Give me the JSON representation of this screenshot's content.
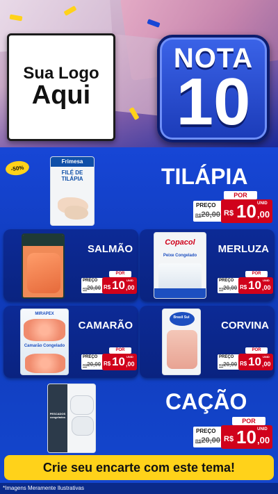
{
  "header": {
    "logo_line1": "Sua Logo",
    "logo_line2": "Aqui",
    "nota_word": "NOTA",
    "nota_number": "10"
  },
  "discount_badge": "-50%",
  "products": [
    {
      "name": "TILÁPIA",
      "brand": "Frimesa",
      "pkg_text": "FILÉ DE TILÁPIA",
      "por": "POR",
      "preco": "PREÇO",
      "old_prefix": "R$",
      "old": "20,00",
      "rs": "R$",
      "new_int": "10",
      "new_dec": ",00",
      "unid": "UNID"
    },
    {
      "name": "SALMÃO",
      "por": "POR",
      "preco": "PREÇO",
      "old_prefix": "R$",
      "old": "20,00",
      "rs": "R$",
      "new_int": "10",
      "new_dec": ",00",
      "unid": "UNID"
    },
    {
      "name": "MERLUZA",
      "brand": "Copacol",
      "pkg_text": "Peixe Congelado",
      "por": "POR",
      "preco": "PREÇO",
      "old_prefix": "R$",
      "old": "20,00",
      "rs": "R$",
      "new_int": "10",
      "new_dec": ",00",
      "unid": "UNID"
    },
    {
      "name": "CAMARÃO",
      "brand": "MIRAPEX",
      "pkg_text": "Camarão Congelado",
      "por": "POR",
      "preco": "PREÇO",
      "old_prefix": "R$",
      "old": "20,00",
      "rs": "R$",
      "new_int": "10",
      "new_dec": ",00",
      "unid": "UNID"
    },
    {
      "name": "CORVINA",
      "brand": "Brasil Sul",
      "por": "POR",
      "preco": "PREÇO",
      "old_prefix": "R$",
      "old": "20,00",
      "rs": "R$",
      "new_int": "10",
      "new_dec": ",00",
      "unid": "UNID"
    },
    {
      "name": "CAÇÃO",
      "pkg_text": "PESCADOS congelados",
      "por": "POR",
      "preco": "PREÇO",
      "old_prefix": "R$",
      "old": "20,00",
      "rs": "R$",
      "new_int": "10",
      "new_dec": ",00",
      "unid": "UNID"
    }
  ],
  "cta": "Crie seu encarte com este tema!",
  "footer_note": "*Imagens Meramente Ilustrativas",
  "colors": {
    "price_red": "#d0021b",
    "cta_yellow": "#ffd21a",
    "panel_blue": "#0c2a96",
    "bg_blue": "#1746d6"
  }
}
